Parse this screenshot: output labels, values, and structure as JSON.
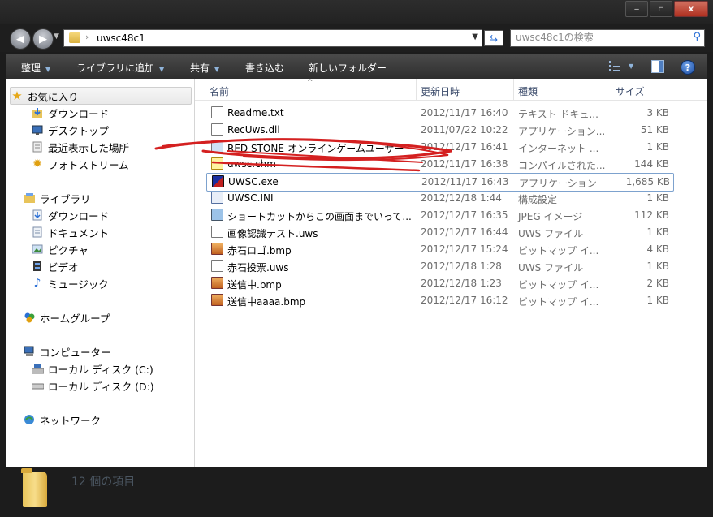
{
  "window": {
    "buttons": {
      "minimize": "‒",
      "maximize": "▫",
      "close": "x"
    }
  },
  "address_bar": {
    "path": "uwsc48c1",
    "separator": "›",
    "search_placeholder": "uwsc48c1の検索"
  },
  "toolbar": {
    "organize": "整理",
    "add_to_library": "ライブラリに追加",
    "share": "共有",
    "burn": "書き込む",
    "new_folder": "新しいフォルダー"
  },
  "sidebar": {
    "favorites": {
      "label": "お気に入り",
      "items": [
        "ダウンロード",
        "デスクトップ",
        "最近表示した場所",
        "フォトストリーム"
      ]
    },
    "libraries": {
      "label": "ライブラリ",
      "items": [
        "ダウンロード",
        "ドキュメント",
        "ピクチャ",
        "ビデオ",
        "ミュージック"
      ]
    },
    "homegroup": "ホームグループ",
    "computer": {
      "label": "コンピューター",
      "items": [
        "ローカル ディスク (C:)",
        "ローカル ディスク (D:)"
      ]
    },
    "network": "ネットワーク"
  },
  "columns": {
    "name": "名前",
    "date": "更新日時",
    "type": "種類",
    "size": "サイズ"
  },
  "files": [
    {
      "name": "Readme.txt",
      "date": "2012/11/17 16:40",
      "type": "テキスト ドキュ...",
      "size": "3 KB",
      "icon": "text-file"
    },
    {
      "name": "RecUws.dll",
      "date": "2011/07/22 10:22",
      "type": "アプリケーション...",
      "size": "51 KB",
      "icon": "dll-file"
    },
    {
      "name": "RED STONE-オンラインゲームユーザー",
      "date": "2012/12/17 16:41",
      "type": "インターネット ...",
      "size": "1 KB",
      "icon": "internet-shortcut"
    },
    {
      "name": "uwsc.chm",
      "date": "2012/11/17 16:38",
      "type": "コンパイルされた...",
      "size": "144 KB",
      "icon": "help-file"
    },
    {
      "name": "UWSC.exe",
      "date": "2012/11/17 16:43",
      "type": "アプリケーション",
      "size": "1,685 KB",
      "icon": "uwsc-exe"
    },
    {
      "name": "UWSC.INI",
      "date": "2012/12/18 1:44",
      "type": "構成設定",
      "size": "1 KB",
      "icon": "ini-file"
    },
    {
      "name": "ショートカットからこの画面までいって...",
      "date": "2012/12/17 16:35",
      "type": "JPEG イメージ",
      "size": "112 KB",
      "icon": "jpeg-file"
    },
    {
      "name": "画像認識テスト.uws",
      "date": "2012/12/17 16:44",
      "type": "UWS ファイル",
      "size": "1 KB",
      "icon": "uws-file"
    },
    {
      "name": "赤石ロゴ.bmp",
      "date": "2012/12/17 15:24",
      "type": "ビットマップ イ...",
      "size": "4 KB",
      "icon": "bmp-file"
    },
    {
      "name": "赤石投票.uws",
      "date": "2012/12/18 1:28",
      "type": "UWS ファイル",
      "size": "1 KB",
      "icon": "uws-file"
    },
    {
      "name": "送信中.bmp",
      "date": "2012/12/18 1:23",
      "type": "ビットマップ イ...",
      "size": "2 KB",
      "icon": "bmp-file"
    },
    {
      "name": "送信中aaaa.bmp",
      "date": "2012/12/17 16:12",
      "type": "ビットマップ イ...",
      "size": "1 KB",
      "icon": "bmp-file"
    }
  ],
  "selected_file": "UWSC.exe",
  "status": {
    "item_count": "12 個の項目"
  },
  "colors": {
    "chrome": "#1c1c1c",
    "accent": "#2a6fd6",
    "selection_border": "#7da2ce",
    "annotation": "#d42020"
  }
}
